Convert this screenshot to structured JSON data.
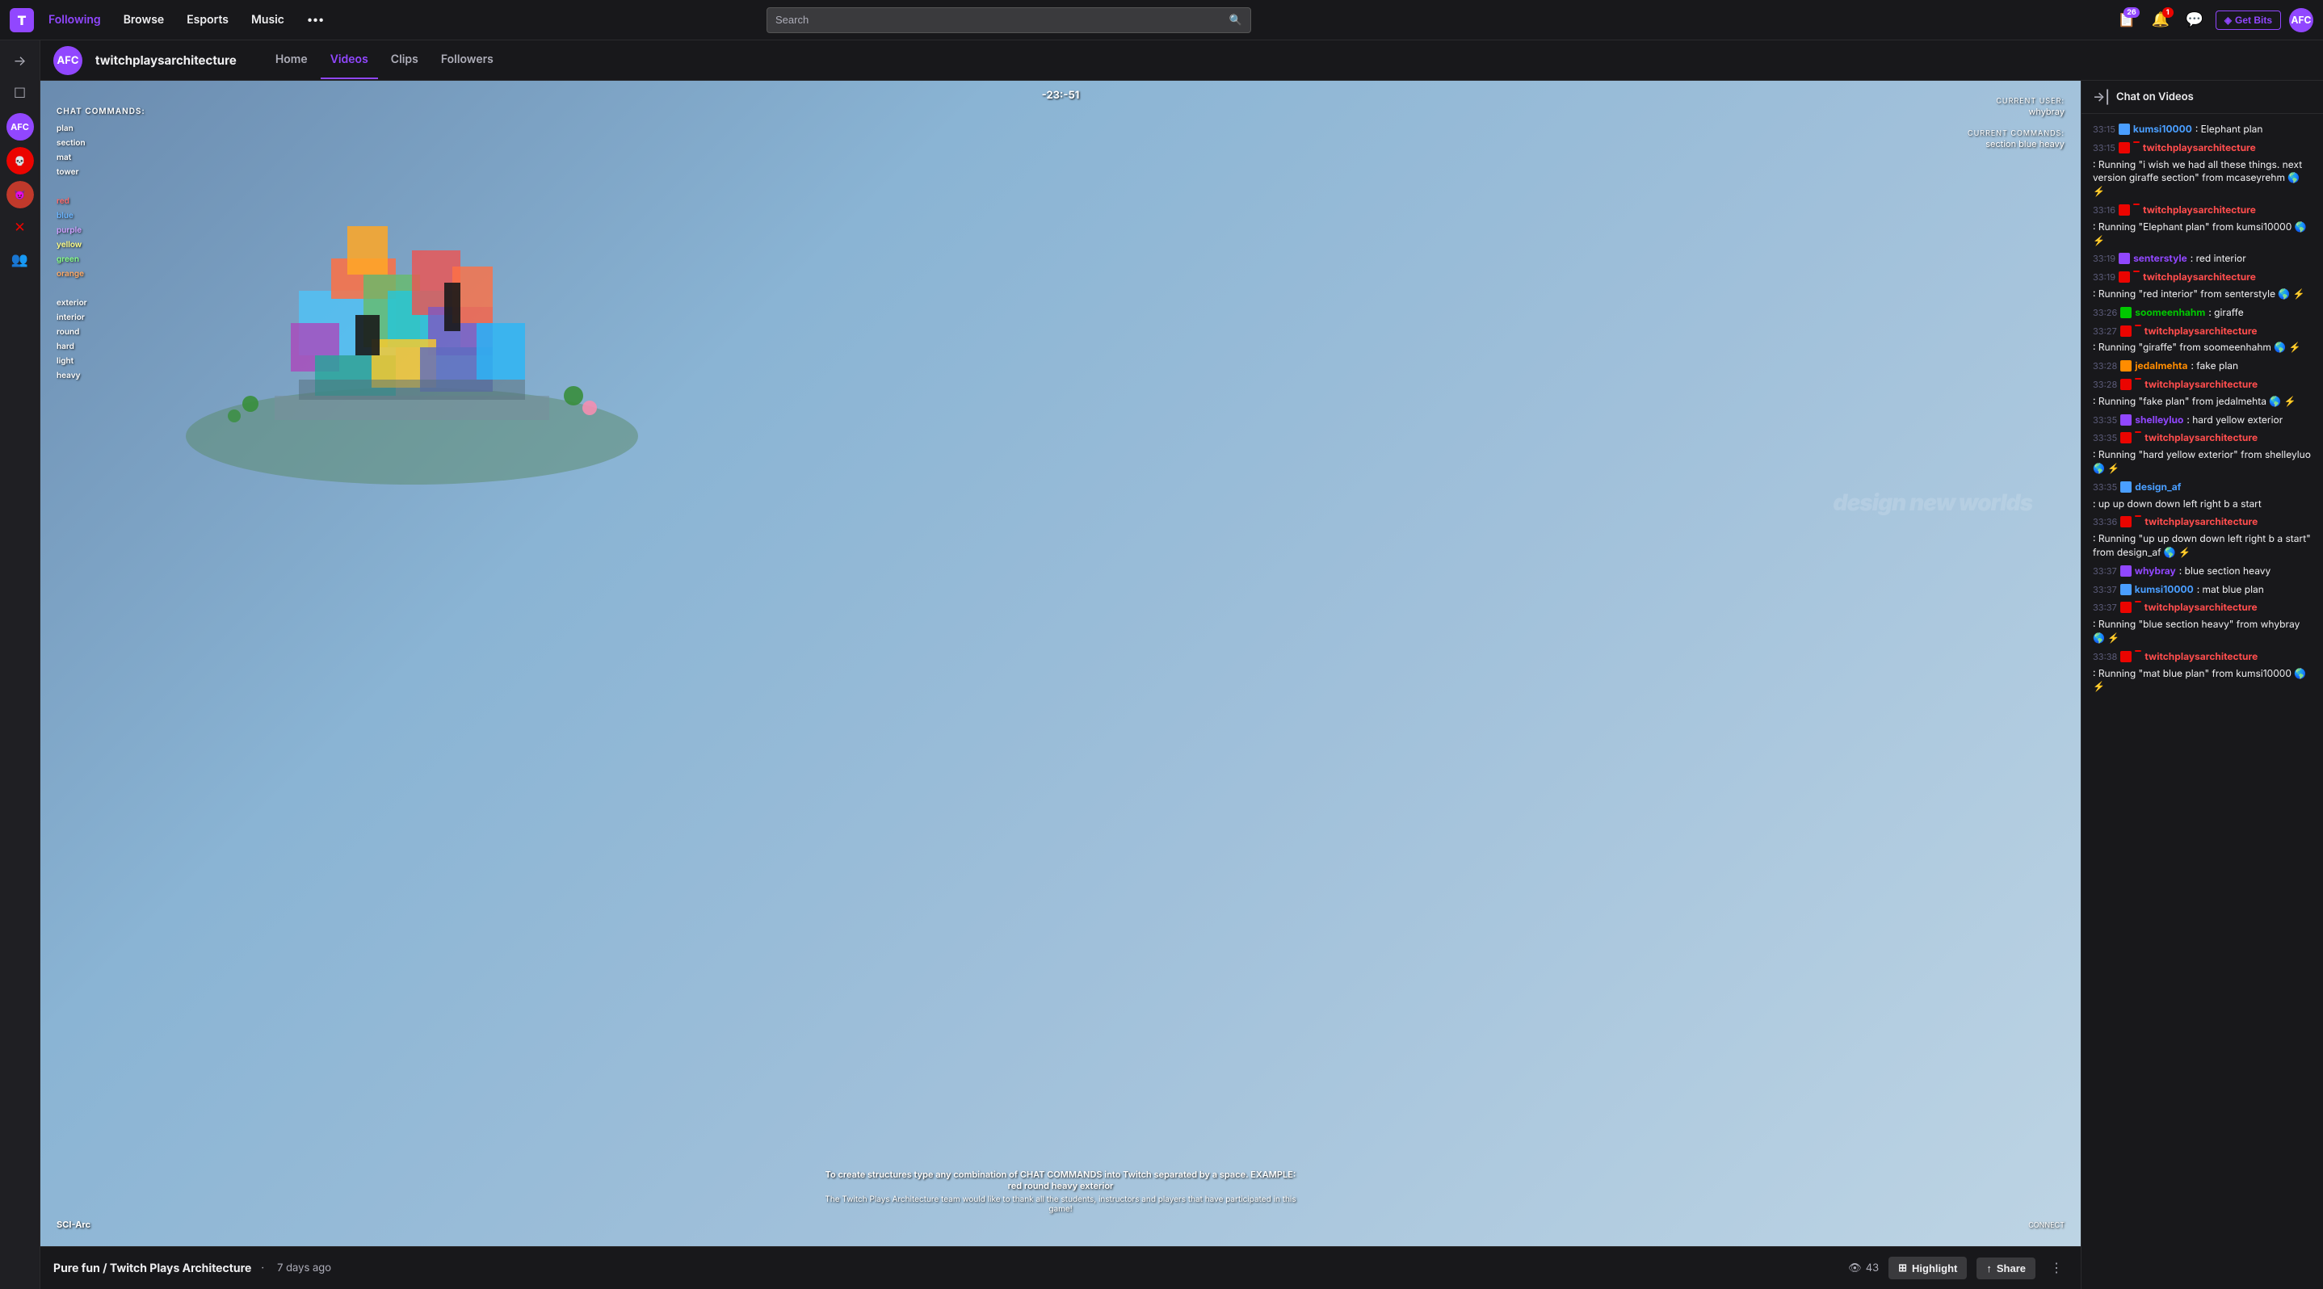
{
  "topnav": {
    "logo": "T",
    "links": [
      {
        "label": "Following",
        "active": true
      },
      {
        "label": "Browse",
        "active": false
      },
      {
        "label": "Esports",
        "active": false
      },
      {
        "label": "Music",
        "active": false
      },
      {
        "label": "•••",
        "active": false
      }
    ],
    "search_placeholder": "Search",
    "badges": {
      "clips": "26",
      "notifications": "1"
    },
    "get_bits": "Get Bits",
    "avatar_initials": "AFC"
  },
  "sidebar": {
    "icons": [
      "→",
      "☐",
      "👤",
      "😈",
      "🎭",
      "✕",
      "👥"
    ]
  },
  "channel": {
    "avatar_initials": "AFC",
    "name": "twitchplaysarchitecture",
    "tabs": [
      {
        "label": "Home",
        "active": false
      },
      {
        "label": "Videos",
        "active": true
      },
      {
        "label": "Clips",
        "active": false
      },
      {
        "label": "Followers",
        "active": false
      }
    ]
  },
  "video": {
    "timer": "-23:-51",
    "current_user_label": "CURRENT USER:",
    "current_user": "whybray",
    "current_commands_label": "CURRENT COMMANDS:",
    "current_commands": "section blue heavy",
    "tagline": "design new worlds",
    "chat_commands_title": "CHAT COMMANDS:",
    "chat_commands": [
      "plan",
      "section",
      "mat",
      "tower",
      "",
      "red",
      "blue",
      "purple",
      "yellow",
      "green",
      "orange",
      "",
      "exterior",
      "interior",
      "round",
      "hard",
      "light",
      "heavy"
    ],
    "footer_main": "To create structures type any combination of CHAT COMMANDS into Twitch separated by a space.  EXAMPLE: red round heavy exterior",
    "footer_sub": "The Twitch Plays Architecture team would like to thank all the students, instructors and players that have participated in this game!",
    "sci_arc": "SCI-Arc",
    "connect": "CONNECT",
    "title": "Pure fun / Twitch Plays Architecture",
    "age": "7 days ago",
    "views": "43",
    "highlight_label": "Highlight",
    "share_label": "Share"
  },
  "chat": {
    "header": "Chat on Videos",
    "messages": [
      {
        "time": "33:15",
        "user": "kumsi10000",
        "user_color": "blue",
        "bot": false,
        "content": ": Elephant plan",
        "avatar_color": "#4a9eff"
      },
      {
        "time": "33:15",
        "user": "twitchplaysarchitecture",
        "user_color": "red",
        "bot": true,
        "content": ": Running \"i wish we had all these things. next version giraffe section\" from mcaseyrehm 🌎 ⚡",
        "avatar_color": "#eb0400"
      },
      {
        "time": "33:16",
        "user": "twitchplaysarchitecture",
        "user_color": "red",
        "bot": true,
        "content": ": Running \"Elephant plan\" from kumsi10000 🌎 ⚡",
        "avatar_color": "#eb0400"
      },
      {
        "time": "33:19",
        "user": "senterstyle",
        "user_color": "purple",
        "bot": false,
        "content": ": red interior",
        "avatar_color": "#9147ff"
      },
      {
        "time": "33:19",
        "user": "twitchplaysarchitecture",
        "user_color": "red",
        "bot": true,
        "content": ": Running \"red interior\" from senterstyle 🌎 ⚡",
        "avatar_color": "#eb0400"
      },
      {
        "time": "33:26",
        "user": "soomeenhahm",
        "user_color": "green",
        "bot": false,
        "content": ": giraffe",
        "avatar_color": "#00c800"
      },
      {
        "time": "33:27",
        "user": "twitchplaysarchitecture",
        "user_color": "red",
        "bot": true,
        "content": ": Running \"giraffe\" from soomeenhahm 🌎 ⚡",
        "avatar_color": "#eb0400"
      },
      {
        "time": "33:28",
        "user": "jedalmehta",
        "user_color": "orange",
        "bot": false,
        "content": ": fake plan",
        "avatar_color": "#ff8c00"
      },
      {
        "time": "33:28",
        "user": "twitchplaysarchitecture",
        "user_color": "red",
        "bot": true,
        "content": ": Running \"fake plan\" from jedalmehta 🌎 ⚡",
        "avatar_color": "#eb0400"
      },
      {
        "time": "33:35",
        "user": "shelleyluo",
        "user_color": "purple",
        "bot": false,
        "content": ": hard yellow exterior",
        "avatar_color": "#9147ff"
      },
      {
        "time": "33:35",
        "user": "twitchplaysarchitecture",
        "user_color": "red",
        "bot": true,
        "content": ": Running \"hard yellow exterior\" from shelleyluo 🌎 ⚡",
        "avatar_color": "#eb0400"
      },
      {
        "time": "33:35",
        "user": "design_af",
        "user_color": "blue",
        "bot": false,
        "content": ": up up down down left right b a start",
        "avatar_color": "#4a9eff"
      },
      {
        "time": "33:36",
        "user": "twitchplaysarchitecture",
        "user_color": "red",
        "bot": true,
        "content": ": Running \"up up down down left right b a start\" from design_af 🌎 ⚡",
        "avatar_color": "#eb0400"
      },
      {
        "time": "33:37",
        "user": "whybray",
        "user_color": "purple",
        "bot": false,
        "content": ": blue section heavy",
        "avatar_color": "#9147ff"
      },
      {
        "time": "33:37",
        "user": "kumsi10000",
        "user_color": "blue",
        "bot": false,
        "content": ": mat blue plan",
        "avatar_color": "#4a9eff"
      },
      {
        "time": "33:37",
        "user": "twitchplaysarchitecture",
        "user_color": "red",
        "bot": true,
        "content": ": Running \"blue section heavy\" from whybray 🌎 ⚡",
        "avatar_color": "#eb0400"
      },
      {
        "time": "33:38",
        "user": "twitchplaysarchitecture",
        "user_color": "red",
        "bot": true,
        "content": ": Running \"mat blue plan\" from kumsi10000 🌎 ⚡",
        "avatar_color": "#eb0400"
      }
    ]
  }
}
